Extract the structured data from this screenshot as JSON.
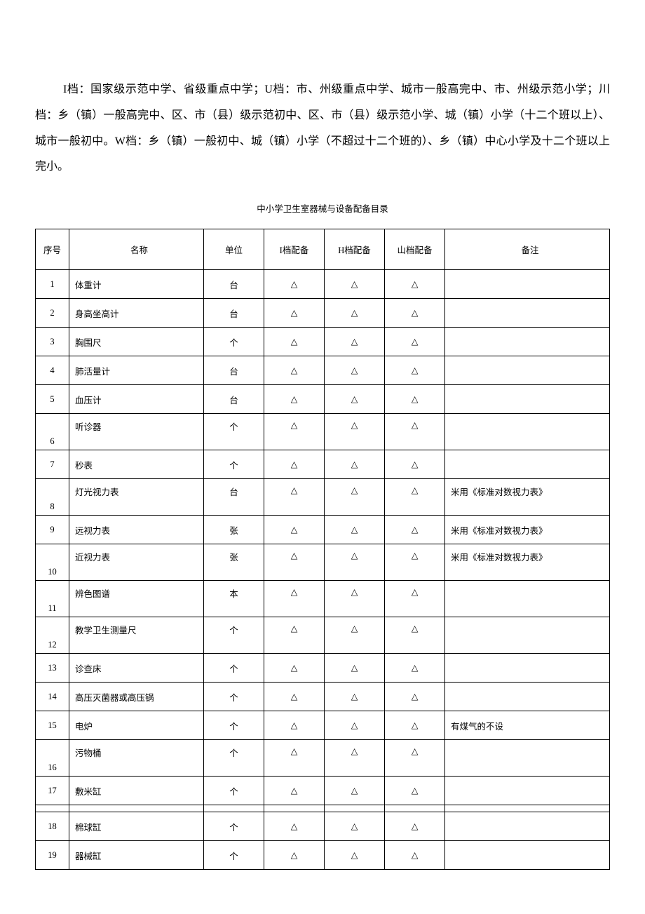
{
  "intro": "I档：国家级示范中学、省级重点中学；U档：市、州级重点中学、城市一般高完中、市、州级示范小学；川档：乡（镇）一般高完中、区、市（县）级示范初中、区、市（县）级示范小学、城（镇）小学（十二个班以上）、城市一般初中。W档：乡（镇）一般初中、城（镇）小学（不超过十二个班的）、乡（镇）中心小学及十二个班以上完小。",
  "caption": "中小学卫生室器械与设备配备目录",
  "headers": {
    "seq": "序号",
    "name": "名称",
    "unit": "单位",
    "g1": "I档配备",
    "g2": "H档配备",
    "g3": "山档配备",
    "note": "备注"
  },
  "mark": "△",
  "rows": [
    {
      "n": "1",
      "name": "体重计",
      "unit": "台",
      "note": ""
    },
    {
      "n": "2",
      "name": "身高坐高计",
      "unit": "台",
      "note": ""
    },
    {
      "n": "3",
      "name": "胸围尺",
      "unit": "个",
      "note": ""
    },
    {
      "n": "4",
      "name": "肺活量计",
      "unit": "台",
      "note": ""
    },
    {
      "n": "5",
      "name": "血压计",
      "unit": "台",
      "note": ""
    },
    {
      "n": "6",
      "name": "听诊器",
      "unit": "个",
      "note": "",
      "offset": true
    },
    {
      "n": "7",
      "name": "秒表",
      "unit": "个",
      "note": ""
    },
    {
      "n": "8",
      "name": "灯光视力表",
      "unit": "台",
      "note": "米用《标准对数视力表》",
      "offset": true
    },
    {
      "n": "9",
      "name": "远视力表",
      "unit": "张",
      "note": "米用《标准对数视力表》"
    },
    {
      "n": "10",
      "name": "近视力表",
      "unit": "张",
      "note": "米用《标准对数视力表》",
      "offset": true
    },
    {
      "n": "11",
      "name": "辨色图谱",
      "unit": "本",
      "note": "",
      "offset": true
    },
    {
      "n": "12",
      "name": "教学卫生测量尺",
      "unit": "个",
      "note": "",
      "offset": true
    },
    {
      "n": "13",
      "name": "诊查床",
      "unit": "个",
      "note": ""
    },
    {
      "n": "14",
      "name": "高压灭菌器或高压锅",
      "unit": "个",
      "note": ""
    },
    {
      "n": "15",
      "name": "电炉",
      "unit": "个",
      "note": "有煤气的不设"
    },
    {
      "n": "16",
      "name": "污物桶",
      "unit": "个",
      "note": "",
      "offset": true
    },
    {
      "n": "17",
      "name": "敷米缸",
      "unit": "个",
      "note": ""
    },
    {
      "n": "18",
      "name": "棉球缸",
      "unit": "个",
      "note": "",
      "gap": true
    },
    {
      "n": "19",
      "name": "器械缸",
      "unit": "个",
      "note": ""
    }
  ]
}
